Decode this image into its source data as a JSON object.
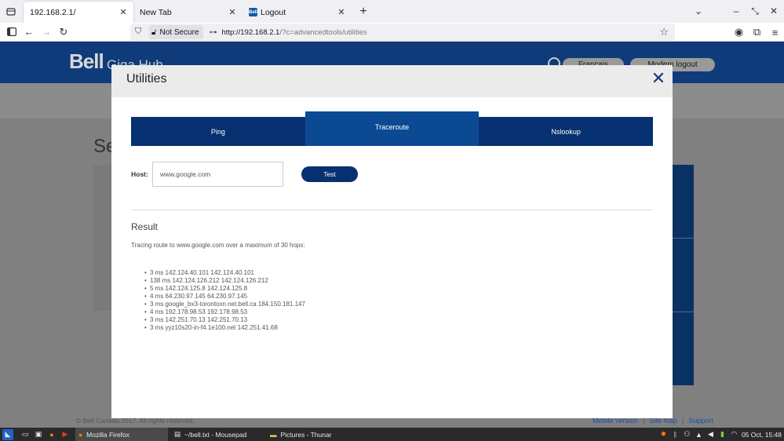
{
  "browser": {
    "tabs": [
      {
        "title": "192.168.2.1/",
        "active": true
      },
      {
        "title": "New Tab",
        "active": false
      },
      {
        "title": "Logout",
        "active": false
      }
    ],
    "not_secure_label": "Not Secure",
    "url_host": "http://192.168.2.1",
    "url_path": "/?c=advancedtools/utilities"
  },
  "site": {
    "logo": "Bell",
    "product": "Giga Hub",
    "lang_button": "Français",
    "logout_button": "Modem logout",
    "heading_partial": "Se",
    "footer_copyright": "© Bell Canada 2017. All rights reserved.",
    "footer_links": [
      "Mobile version",
      "Site map",
      "Support"
    ]
  },
  "modal": {
    "title": "Utilities",
    "tabs": [
      {
        "label": "Ping",
        "active": false
      },
      {
        "label": "Traceroute",
        "active": true
      },
      {
        "label": "Nslookup",
        "active": false
      }
    ],
    "host_label": "Host:",
    "host_value": "www.google.com",
    "test_button": "Test",
    "result_title": "Result",
    "trace_intro": "Tracing route to www.google.com over a maximum of 30 hops:",
    "hops": [
      "3 ms 142.124.40.101 142.124.40.101",
      "138 ms 142.124.126.212 142.124.126.212",
      "5 ms 142.124.125.8 142.124.125.8",
      "4 ms 64.230.97.145 64.230.97.145",
      "3 ms google_bx3-torontoxn.net.bell.ca 184.150.181.147",
      "4 ms 192.178.98.53 192.178.98.53",
      "3 ms 142.251.70.13 142.251.70.13",
      "3 ms yyz10s20-in-f4.1e100.net 142.251.41.68"
    ]
  },
  "taskbar": {
    "tasks": [
      {
        "label": "Mozilla Firefox",
        "active": true
      },
      {
        "label": "~/bell.txt - Mousepad",
        "active": false
      },
      {
        "label": "Pictures - Thunar",
        "active": false
      }
    ],
    "clock": "05 Oct, 15:48"
  }
}
